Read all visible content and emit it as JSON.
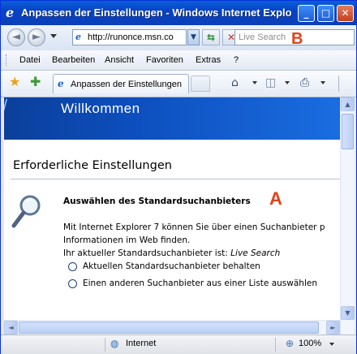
{
  "window": {
    "title": "Anpassen der Einstellungen - Windows Internet Explo",
    "minimize_glyph": "_",
    "maximize_glyph": "□",
    "close_glyph": "✕"
  },
  "address": {
    "url": "http://runonce.msn.co",
    "search_placeholder": "Live Search"
  },
  "annotations": {
    "marker_b": "B",
    "marker_a": "A"
  },
  "menu": {
    "items": [
      {
        "label": "Datei"
      },
      {
        "label": "Bearbeiten"
      },
      {
        "label": "Ansicht"
      },
      {
        "label": "Favoriten"
      },
      {
        "label": "Extras"
      },
      {
        "label": "?"
      }
    ]
  },
  "tabs": {
    "active_label": "Anpassen der Einstellungen"
  },
  "page": {
    "banner_title": "Willkommen",
    "heading": "Erforderliche Einstellungen",
    "section_title": "Auswählen des Standardsuchanbieters",
    "paragraph_line1": "Mit Internet Explorer 7 können Sie über einen Suchanbieter p",
    "paragraph_line2": "Informationen im Web finden.",
    "current_provider_prefix": "Ihr aktueller Standardsuchanbieter ist: ",
    "current_provider": "Live Search",
    "options": [
      {
        "label": "Aktuellen Standardsuchanbieter behalten"
      },
      {
        "label": "Einen anderen Suchanbieter aus einer Liste auswählen"
      }
    ]
  },
  "statusbar": {
    "zone": "Internet",
    "zoom": "100%"
  },
  "icons": {
    "back": "back-arrow-icon",
    "forward": "forward-arrow-icon",
    "refresh": "refresh-icon",
    "stop": "stop-icon",
    "favorites": "favorites-star-icon",
    "add_favorites": "add-favorites-icon",
    "home": "home-icon",
    "feeds": "feeds-icon",
    "print": "print-icon",
    "magnifier": "magnifier-icon",
    "globe": "globe-icon"
  },
  "colors": {
    "titlebar": "#0a4fcc",
    "banner": "#0d4fbf",
    "marker": "#e0421b"
  }
}
